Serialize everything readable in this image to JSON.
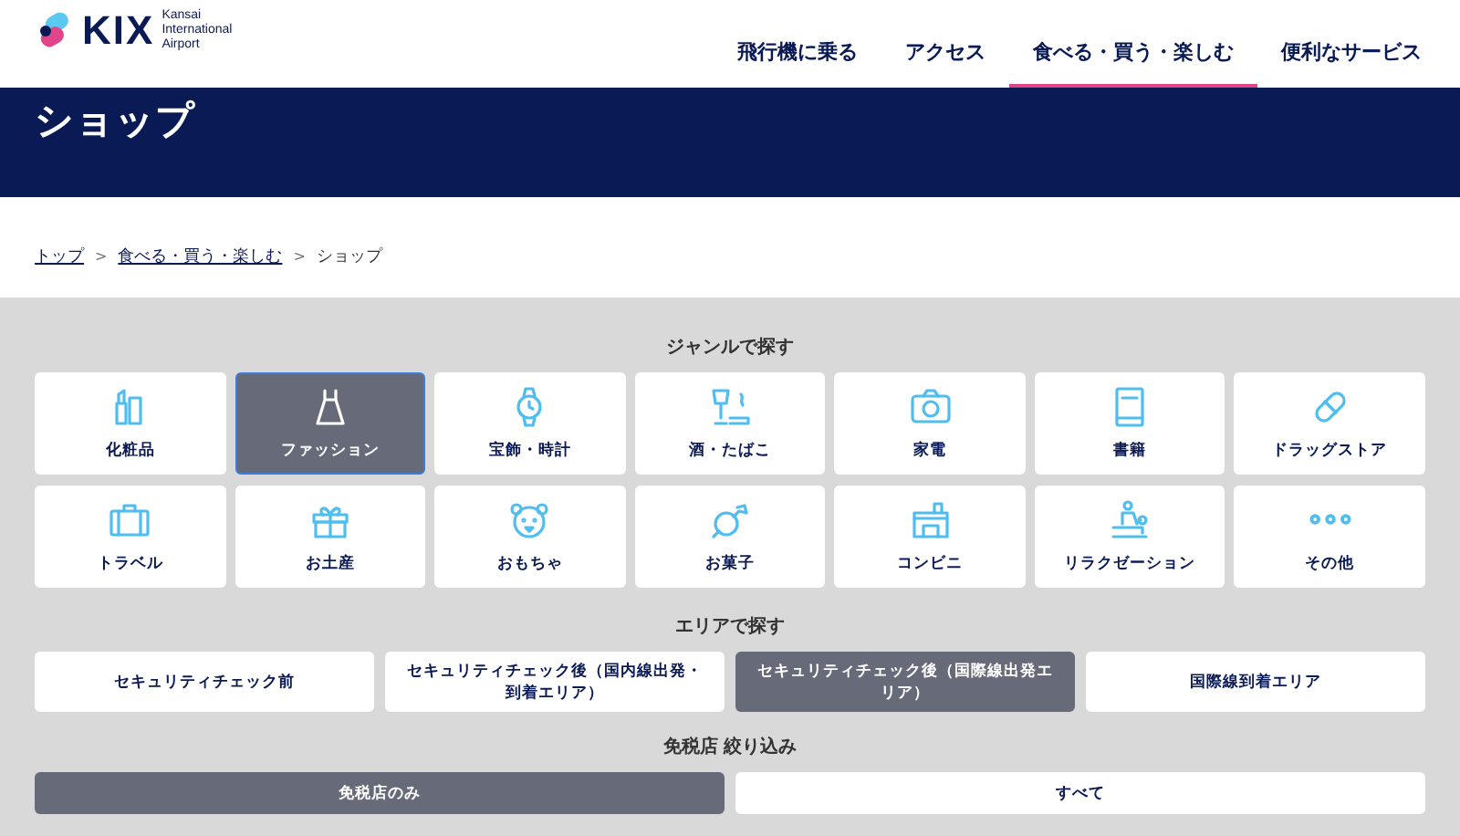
{
  "header": {
    "logo": {
      "mark": "KIX",
      "lines": [
        "Kansai",
        "International",
        "Airport"
      ]
    },
    "nav": [
      {
        "label": "飛行機に乗る",
        "selected": false
      },
      {
        "label": "アクセス",
        "selected": false
      },
      {
        "label": "食べる・買う・楽しむ",
        "selected": true
      },
      {
        "label": "便利なサービス",
        "selected": false
      }
    ]
  },
  "page_title": "ショップ",
  "breadcrumb": [
    {
      "label": "トップ",
      "link": true
    },
    {
      "separator": ">",
      "label": "食べる・買う・楽しむ",
      "link": true
    },
    {
      "separator": ">",
      "label": "ショップ",
      "link": false
    }
  ],
  "genres": {
    "heading": "ジャンルで探す",
    "items": [
      {
        "label": "化粧品",
        "selected": false
      },
      {
        "label": "ファッション",
        "selected": true
      },
      {
        "label": "宝飾・時計",
        "selected": false
      },
      {
        "label": "酒・たばこ",
        "selected": false
      },
      {
        "label": "家電",
        "selected": false
      },
      {
        "label": "書籍",
        "selected": false
      },
      {
        "label": "ドラッグストア",
        "selected": false
      },
      {
        "label": "トラベル",
        "selected": false
      },
      {
        "label": "お土産",
        "selected": false
      },
      {
        "label": "おもちゃ",
        "selected": false
      },
      {
        "label": "お菓子",
        "selected": false
      },
      {
        "label": "コンビニ",
        "selected": false
      },
      {
        "label": "リラクゼーション",
        "selected": false
      },
      {
        "label": "その他",
        "selected": false
      }
    ]
  },
  "areas": {
    "heading": "エリアで探す",
    "items": [
      {
        "label": "セキュリティチェック前",
        "selected": false
      },
      {
        "label": "セキュリティチェック後（国内線出発・到着エリア）",
        "selected": false
      },
      {
        "label": "セキュリティチェック後（国際線出発エリア）",
        "selected": true
      },
      {
        "label": "国際線到着エリア",
        "selected": false
      }
    ]
  },
  "duty_free": {
    "heading": "免税店 絞り込み",
    "items": [
      {
        "label": "免税店のみ",
        "selected": true
      },
      {
        "label": "すべて",
        "selected": false
      }
    ]
  }
}
